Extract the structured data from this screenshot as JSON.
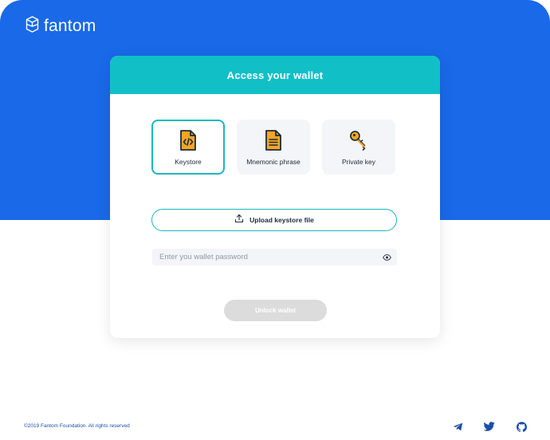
{
  "brand": {
    "name": "fantom",
    "colors": {
      "primary_blue": "#1969e8",
      "teal": "#10c0c6",
      "orange": "#f5a623"
    }
  },
  "card": {
    "title": "Access your wallet",
    "options": [
      {
        "label": "Keystore",
        "icon": "keystore-file-icon",
        "selected": true
      },
      {
        "label": "Mnemonic phrase",
        "icon": "document-icon",
        "selected": false
      },
      {
        "label": "Private key",
        "icon": "key-icon",
        "selected": false
      }
    ],
    "upload_label": "Upload keystore file",
    "password_placeholder": "Enter you wallet password",
    "unlock_label": "Unlock wallet"
  },
  "footer": {
    "copyright": "©2019 Fantom Foundation. All rights reserved",
    "social": [
      "telegram-icon",
      "twitter-icon",
      "github-icon"
    ]
  }
}
